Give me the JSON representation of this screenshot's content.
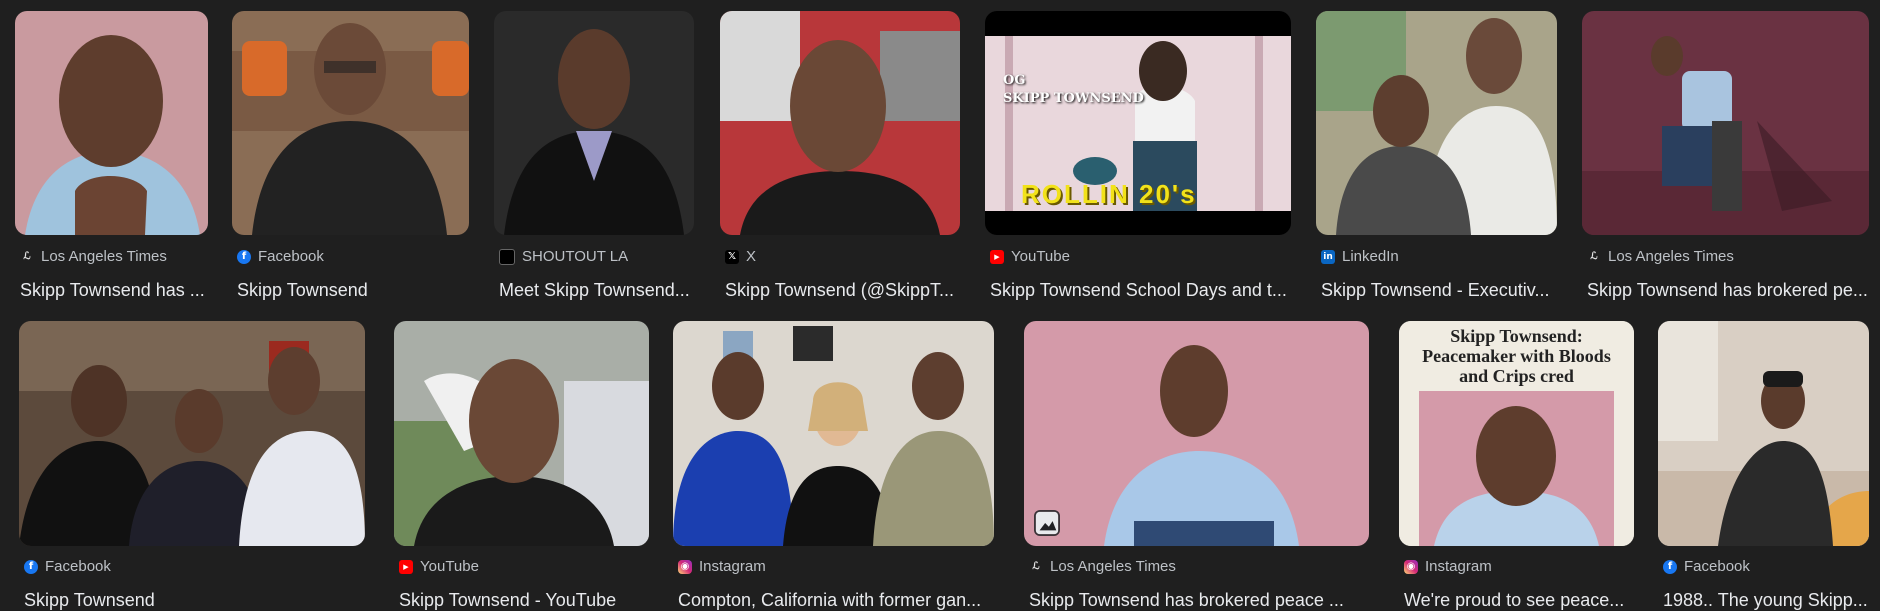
{
  "results": [
    {
      "source": "Los Angeles Times",
      "title": "Skipp Townsend has ...",
      "icon": "la-times-icon"
    },
    {
      "source": "Facebook",
      "title": "Skipp Townsend",
      "icon": "facebook-icon"
    },
    {
      "source": "SHOUTOUT LA",
      "title": "Meet Skipp Townsend...",
      "icon": "shoutout-la-icon"
    },
    {
      "source": "X",
      "title": "Skipp Townsend (@SkippT...",
      "icon": "x-icon"
    },
    {
      "source": "YouTube",
      "title": "Skipp Townsend School Days and t...",
      "icon": "youtube-icon",
      "overlay_text_1": "OG",
      "overlay_text_2": "SKIPP TOWNSEND",
      "overlay_text_3": "ROLLIN 20's"
    },
    {
      "source": "LinkedIn",
      "title": "Skipp Townsend - Executiv...",
      "icon": "linkedin-icon"
    },
    {
      "source": "Los Angeles Times",
      "title": "Skipp Townsend has brokered pe...",
      "icon": "la-times-icon"
    },
    {
      "source": "Facebook",
      "title": "Skipp Townsend",
      "icon": "facebook-icon"
    },
    {
      "source": "YouTube",
      "title": "Skipp Townsend - YouTube",
      "icon": "youtube-icon"
    },
    {
      "source": "Instagram",
      "title": "Compton, California with former gan...",
      "icon": "instagram-icon"
    },
    {
      "source": "Los Angeles Times",
      "title": "Skipp Townsend has brokered peace ...",
      "icon": "la-times-icon"
    },
    {
      "source": "Instagram",
      "title": "We're proud to see peace...",
      "icon": "instagram-icon",
      "overlay_text_1": "Skipp Townsend:",
      "overlay_text_2": "Peacemaker with Bloods",
      "overlay_text_3": "and Crips cred"
    },
    {
      "source": "Facebook",
      "title": "1988.. The young Skipp...",
      "icon": "facebook-icon"
    }
  ],
  "colors": {
    "background": "#1f1f1f",
    "source_text": "#bdc1c6",
    "title_text": "#e8eaed",
    "facebook": "#1877f2",
    "youtube": "#ff0000",
    "linkedin": "#0a66c2",
    "instagram": "#d62976"
  }
}
